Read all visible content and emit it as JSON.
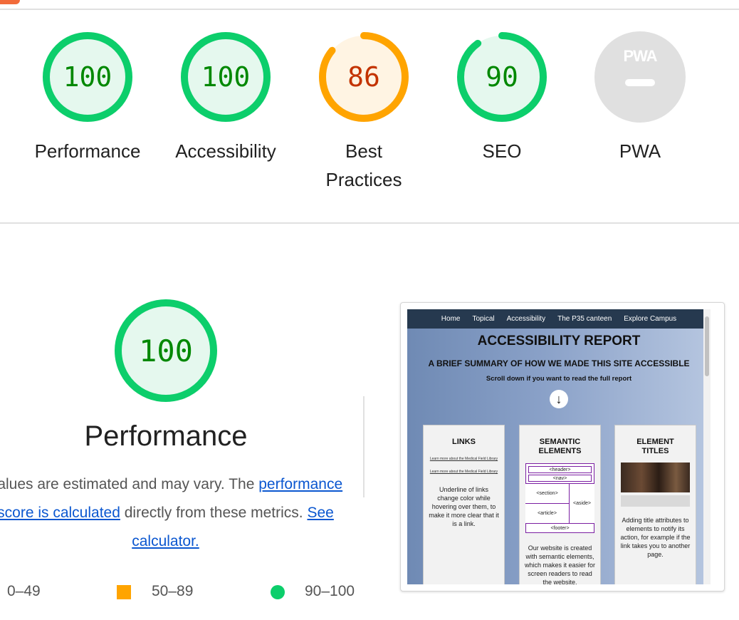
{
  "colors": {
    "pass": "#0cce6b",
    "pass_text": "#008800",
    "pass_bg": "#e5f8ee",
    "average": "#ffa400",
    "average_text": "#c33300",
    "average_bg": "#fff4e3",
    "na": "#e0e0e0",
    "link": "#0b57d0"
  },
  "gauges": [
    {
      "label": "Performance",
      "score": "100",
      "value": 1.0,
      "rating": "pass"
    },
    {
      "label": "Accessibility",
      "score": "100",
      "value": 1.0,
      "rating": "pass"
    },
    {
      "label_line1": "Best",
      "label_line2": "Practices",
      "score": "86",
      "value": 0.86,
      "rating": "average"
    },
    {
      "label": "SEO",
      "score": "90",
      "value": 0.9,
      "rating": "pass"
    },
    {
      "label": "PWA",
      "badge_text": "PWA",
      "rating": "na"
    }
  ],
  "performance": {
    "score": "100",
    "title": "Performance",
    "desc_before": "Values are estimated and may vary. The ",
    "desc_link": "performance score is calculated",
    "desc_after": " directly from these metrics. ",
    "calc_link": "See calculator."
  },
  "legend": [
    {
      "range": "0–49",
      "icon": "fail-triangle-icon"
    },
    {
      "range": "50–89",
      "icon": "average-square-icon"
    },
    {
      "range": "90–100",
      "icon": "pass-circle-icon"
    }
  ],
  "screenshot": {
    "nav": [
      "Home",
      "Topical",
      "Accessibility",
      "The P35 canteen",
      "Explore Campus"
    ],
    "title": "ACCESSIBILITY REPORT",
    "subtitle": "A BRIEF SUMMARY OF HOW WE MADE THIS SITE ACCESSIBLE",
    "scroll_hint": "Scroll down if you want to read the full report",
    "arrow": "↓",
    "cards": {
      "links": {
        "title": "LINKS",
        "small1": "Learn more about the Medical Field Library",
        "small2": "Learn more about the Medical Field Library",
        "text": "Underline of links change color while hovering over them, to make it more clear that it is a link."
      },
      "semantic": {
        "title_line1": "SEMANTIC",
        "title_line2": "ELEMENTS",
        "header": "<header>",
        "nav": "<nav>",
        "section": "<section>",
        "aside": "<aside>",
        "article": "<article>",
        "footer": "<footer>",
        "text": "Our website is created with semantic elements, which makes it easier for screen readers to read the website."
      },
      "element": {
        "title_line1": "ELEMENT",
        "title_line2": "TITLES",
        "text": "Adding title attributes to elements to notify its action, for example if the link takes you to another page."
      }
    }
  }
}
